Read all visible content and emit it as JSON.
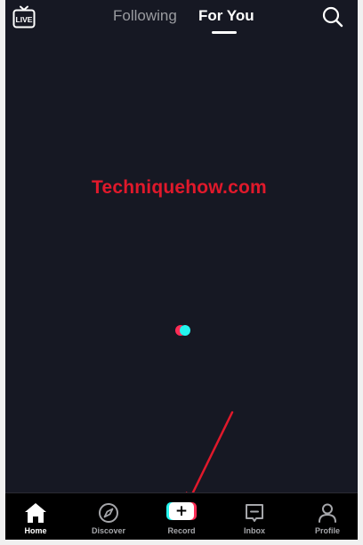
{
  "top_bar": {
    "live_label": "LIVE",
    "tabs": [
      {
        "label": "Following",
        "active": false
      },
      {
        "label": "For You",
        "active": true
      }
    ]
  },
  "watermark": {
    "text": "Techniquehow.com"
  },
  "bottom_nav": {
    "items": [
      {
        "label": "Home",
        "icon": "home-icon",
        "active": true
      },
      {
        "label": "Discover",
        "icon": "compass-icon",
        "active": false
      },
      {
        "label": "Record",
        "icon": "plus-icon",
        "active": false
      },
      {
        "label": "Inbox",
        "icon": "inbox-icon",
        "active": false
      },
      {
        "label": "Profile",
        "icon": "person-icon",
        "active": false
      }
    ],
    "record_symbol": "+"
  },
  "colors": {
    "background": "#161823",
    "accent_red": "#fe2c55",
    "accent_cyan": "#25f4ee",
    "watermark_red": "#e0192b",
    "inactive_text": "#9a9ba0"
  }
}
